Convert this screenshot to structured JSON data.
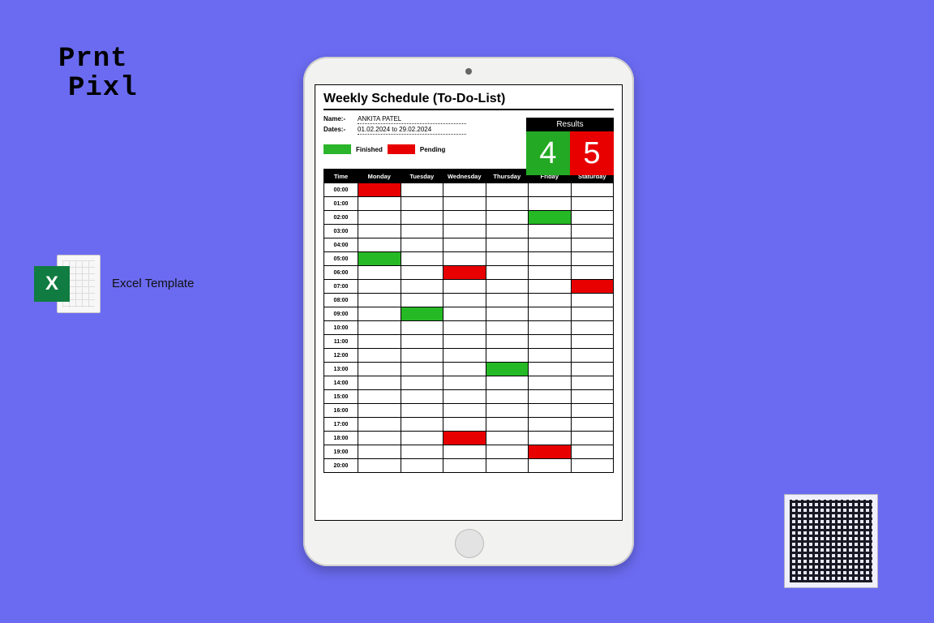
{
  "brand": {
    "line1": "Prnt",
    "line2": "Pixl"
  },
  "excel": {
    "letter": "X",
    "label": "Excel Template"
  },
  "sheet": {
    "title": "Weekly Schedule (To-Do-List)",
    "name_label": "Name:-",
    "name_value": "ANKITA PATEL",
    "dates_label": "Dates:-",
    "dates_value": "01.02.2024 to 29.02.2024",
    "legend": {
      "finished": "Finished",
      "pending": "Pending"
    },
    "results": {
      "header": "Results",
      "finished": "4",
      "pending": "5"
    },
    "columns": [
      "Time",
      "Monday",
      "Tuesday",
      "Wednesday",
      "Thursday",
      "Friday",
      "Staturday"
    ],
    "times": [
      "00:00",
      "01:00",
      "02:00",
      "03:00",
      "04:00",
      "05:00",
      "06:00",
      "07:00",
      "08:00",
      "09:00",
      "10:00",
      "11:00",
      "12:00",
      "13:00",
      "14:00",
      "15:00",
      "16:00",
      "17:00",
      "18:00",
      "19:00",
      "20:00"
    ],
    "cells": {
      "00:00": {
        "Monday": "pending"
      },
      "02:00": {
        "Friday": "finished"
      },
      "05:00": {
        "Monday": "finished"
      },
      "06:00": {
        "Wednesday": "pending"
      },
      "07:00": {
        "Staturday": "pending"
      },
      "09:00": {
        "Tuesday": "finished"
      },
      "13:00": {
        "Thursday": "finished"
      },
      "18:00": {
        "Wednesday": "pending"
      },
      "19:00": {
        "Friday": "pending"
      }
    }
  },
  "chart_data": {
    "type": "table",
    "title": "Weekly Schedule (To-Do-List)",
    "x_categories": [
      "Monday",
      "Tuesday",
      "Wednesday",
      "Thursday",
      "Friday",
      "Staturday"
    ],
    "y_categories": [
      "00:00",
      "01:00",
      "02:00",
      "03:00",
      "04:00",
      "05:00",
      "06:00",
      "07:00",
      "08:00",
      "09:00",
      "10:00",
      "11:00",
      "12:00",
      "13:00",
      "14:00",
      "15:00",
      "16:00",
      "17:00",
      "18:00",
      "19:00",
      "20:00"
    ],
    "legend": {
      "finished": "green",
      "pending": "red"
    },
    "entries": [
      {
        "time": "00:00",
        "day": "Monday",
        "status": "pending"
      },
      {
        "time": "02:00",
        "day": "Friday",
        "status": "finished"
      },
      {
        "time": "05:00",
        "day": "Monday",
        "status": "finished"
      },
      {
        "time": "06:00",
        "day": "Wednesday",
        "status": "pending"
      },
      {
        "time": "07:00",
        "day": "Staturday",
        "status": "pending"
      },
      {
        "time": "09:00",
        "day": "Tuesday",
        "status": "finished"
      },
      {
        "time": "13:00",
        "day": "Thursday",
        "status": "finished"
      },
      {
        "time": "18:00",
        "day": "Wednesday",
        "status": "pending"
      },
      {
        "time": "19:00",
        "day": "Friday",
        "status": "pending"
      }
    ],
    "summary": {
      "finished": 4,
      "pending": 5
    }
  }
}
